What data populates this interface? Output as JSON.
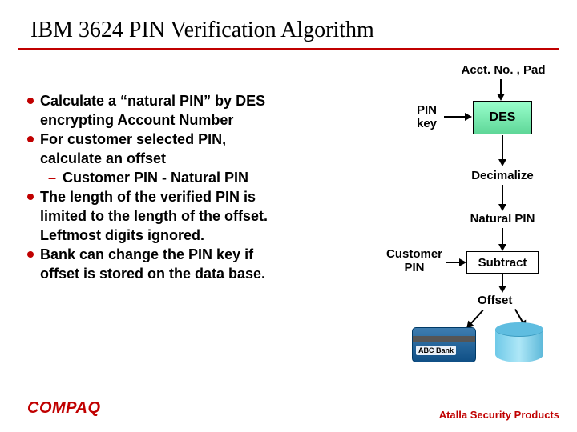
{
  "title": "IBM 3624 PIN Verification Algorithm",
  "bullets": {
    "b1a": "Calculate a “natural PIN” by DES",
    "b1b": "encrypting Account Number",
    "b2a": "For customer selected PIN,",
    "b2b": "calculate an offset",
    "s1": "Customer PIN - Natural PIN",
    "b3a": "The length of the verified PIN is",
    "b3b": "limited to the length of the offset.",
    "b3c": "Leftmost digits ignored.",
    "b4a": "Bank can change the PIN key if",
    "b4b": "offset is stored on the data base."
  },
  "diagram": {
    "acct": "Acct. No. , Pad",
    "pinkey": "PIN\nkey",
    "des": "DES",
    "decimalize": "Decimalize",
    "natural": "Natural PIN",
    "customer": "Customer\nPIN",
    "subtract": "Subtract",
    "offset": "Offset",
    "bank": "ABC Bank"
  },
  "footer": "Atalla Security Products",
  "logo": "COMPAQ"
}
